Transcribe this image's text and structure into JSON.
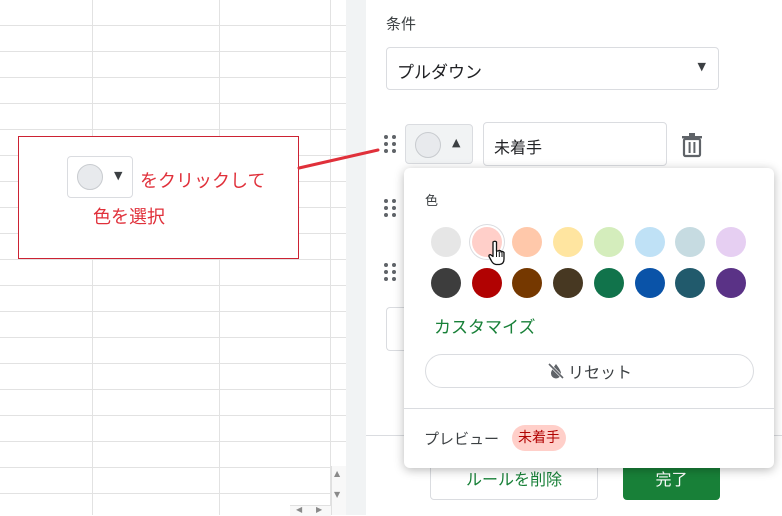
{
  "panel": {
    "condition_label": "条件",
    "condition_value": "プルダウン",
    "options": [
      {
        "text": "未着手",
        "color": "#e8eaed"
      }
    ],
    "delete_rule_label": "ルールを削除",
    "done_label": "完了"
  },
  "color_popup": {
    "title": "色",
    "swatches_row1": [
      "#e6e6e6",
      "#ffcfc9",
      "#ffc8aa",
      "#ffe5a0",
      "#d4edbc",
      "#bfe1f6",
      "#c6dbe1",
      "#e6cff2"
    ],
    "swatches_row2": [
      "#3d3d3d",
      "#b10202",
      "#753800",
      "#473822",
      "#11734b",
      "#0a53a8",
      "#215a6c",
      "#5a3286"
    ],
    "selected_swatch_index": 1,
    "customize_label": "カスタマイズ",
    "reset_label": "リセット",
    "preview_label": "プレビュー",
    "preview_chip_text": "未着手",
    "preview_chip_bg": "#ffcfc9",
    "preview_chip_fg": "#b10202"
  },
  "annotation": {
    "line1": "をクリックして",
    "line2": "色を選択",
    "color": "#e0303a"
  },
  "icons": {
    "trash": "trash-icon",
    "drag": "drag-handle-icon",
    "reset": "reset-icon",
    "cursor": "hand-cursor-icon"
  }
}
